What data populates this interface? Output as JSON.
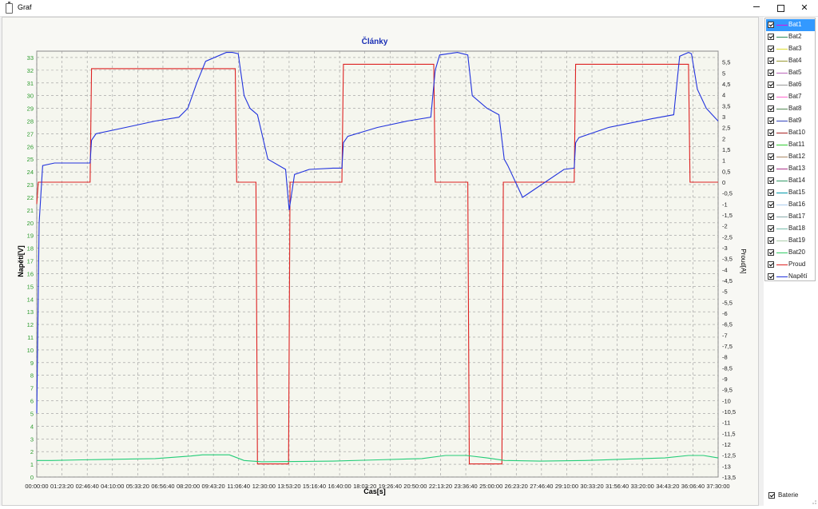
{
  "window": {
    "title": "Graf"
  },
  "chart_data": {
    "type": "line",
    "title": "Články",
    "xlabel": "Čas[s]",
    "ylabel": "Napětí[V]",
    "y2label": "Proud[A]",
    "xlim": [
      0,
      2300
    ],
    "ylim": [
      0,
      33.5
    ],
    "y2lim": [
      -13.5,
      6
    ],
    "x_ticks": [
      "00:00:00",
      "01:23:20",
      "02:46:40",
      "04:10:00",
      "05:33:20",
      "06:56:40",
      "08:20:00",
      "09:43:20",
      "11:06:40",
      "12:30:00",
      "13:53:20",
      "15:16:40",
      "16:40:00",
      "18:03:20",
      "19:26:40",
      "20:50:00",
      "22:13:20",
      "23:36:40",
      "25:00:00",
      "26:23:20",
      "27:46:40",
      "29:10:00",
      "30:33:20",
      "31:56:40",
      "33:20:00",
      "34:43:20",
      "36:06:40",
      "37:30:00"
    ],
    "y_ticks": [
      "0",
      "1",
      "2",
      "3",
      "4",
      "5",
      "6",
      "7",
      "8",
      "9",
      "10",
      "11",
      "12",
      "13",
      "14",
      "15",
      "16",
      "17",
      "18",
      "19",
      "20",
      "21",
      "22",
      "23",
      "24",
      "25",
      "26",
      "27",
      "28",
      "29",
      "30",
      "31",
      "32",
      "33"
    ],
    "y2_ticks": [
      "-13,5",
      "-13",
      "-12,5",
      "-12",
      "-11,5",
      "-11",
      "-10,5",
      "-10",
      "-9,5",
      "-9",
      "-8,5",
      "-8",
      "-7,5",
      "-7",
      "-6,5",
      "-6",
      "-5,5",
      "-5",
      "-4,5",
      "-4",
      "-3,5",
      "-3",
      "-2,5",
      "-2",
      "-1,5",
      "-1",
      "-0,5",
      "0",
      "0,5",
      "1",
      "1,5",
      "2",
      "2,5",
      "3",
      "3,5",
      "4",
      "4,5",
      "5",
      "5,5"
    ],
    "grid": true,
    "legend_position": "right",
    "series": [
      {
        "name": "Proud",
        "color": "#dd2222",
        "axis": "right",
        "x": [
          0,
          5,
          180,
          185,
          670,
          675,
          740,
          745,
          850,
          855,
          1030,
          1035,
          1340,
          1345,
          1455,
          1460,
          1570,
          1575,
          1814,
          1819,
          2200,
          2205,
          2300
        ],
        "y": [
          -1,
          0,
          0,
          5.2,
          5.2,
          0,
          0,
          -12.9,
          -12.9,
          0,
          0,
          5.4,
          5.4,
          0,
          0,
          -12.9,
          -12.9,
          0,
          0,
          5.4,
          5.4,
          0,
          0
        ]
      },
      {
        "name": "Napětí",
        "color": "#2233dd",
        "axis": "left",
        "x": [
          0,
          8,
          20,
          60,
          180,
          185,
          200,
          300,
          400,
          480,
          510,
          540,
          570,
          640,
          660,
          680,
          700,
          720,
          745,
          780,
          840,
          852,
          870,
          920,
          1000,
          1030,
          1035,
          1050,
          1150,
          1250,
          1330,
          1345,
          1360,
          1420,
          1455,
          1470,
          1520,
          1560,
          1578,
          1590,
          1640,
          1780,
          1814,
          1819,
          1830,
          1930,
          2080,
          2150,
          2170,
          2200,
          2210,
          2230,
          2260,
          2300
        ],
        "y": [
          5,
          20,
          24.5,
          24.7,
          24.7,
          26.5,
          27,
          27.5,
          28,
          28.3,
          29,
          31,
          32.7,
          33.4,
          33.4,
          33.3,
          30,
          29,
          28.5,
          25,
          24.2,
          21,
          23.8,
          24.2,
          24.3,
          24.3,
          26.3,
          26.8,
          27.5,
          28,
          28.3,
          32,
          33.2,
          33.4,
          33.2,
          30,
          29,
          28.5,
          25,
          24.5,
          22,
          24.2,
          24.3,
          26.3,
          26.7,
          27.5,
          28.2,
          28.5,
          33.1,
          33.4,
          33.3,
          30.5,
          29,
          28
        ]
      },
      {
        "name": "Bat1",
        "color": "#22cc77",
        "axis": "left",
        "x": [
          0,
          50,
          150,
          400,
          520,
          560,
          650,
          700,
          760,
          1000,
          1150,
          1300,
          1380,
          1450,
          1520,
          1580,
          1700,
          1850,
          1980,
          2120,
          2200,
          2250,
          2300
        ],
        "y": [
          1.3,
          1.3,
          1.35,
          1.45,
          1.65,
          1.75,
          1.75,
          1.3,
          1.2,
          1.25,
          1.35,
          1.45,
          1.7,
          1.7,
          1.5,
          1.3,
          1.25,
          1.3,
          1.4,
          1.5,
          1.7,
          1.7,
          1.5
        ]
      }
    ]
  },
  "legend": {
    "items": [
      "Bat1",
      "Bat2",
      "Bat3",
      "Bat4",
      "Bat5",
      "Bat6",
      "Bat7",
      "Bat8",
      "Bat9",
      "Bat10",
      "Bat11",
      "Bat12",
      "Bat13",
      "Bat14",
      "Bat15",
      "Bat16",
      "Bat17",
      "Bat18",
      "Bat19",
      "Bat20",
      "Proud",
      "Napětí"
    ],
    "colors": [
      "#e011e0",
      "#2e8b57",
      "#dddd33",
      "#999933",
      "#bb66bb",
      "#999999",
      "#ff66cc",
      "#558855",
      "#3344bb",
      "#aa2222",
      "#33cc33",
      "#aa8866",
      "#aa3388",
      "#339966",
      "#0099aa",
      "#aaccee",
      "#88aaaa",
      "#77bbaa",
      "#aaccaa",
      "#33cc66",
      "#dd2222",
      "#2233dd"
    ],
    "selected": "Bat1"
  },
  "baterie": {
    "label": "Baterie",
    "checked": true
  }
}
